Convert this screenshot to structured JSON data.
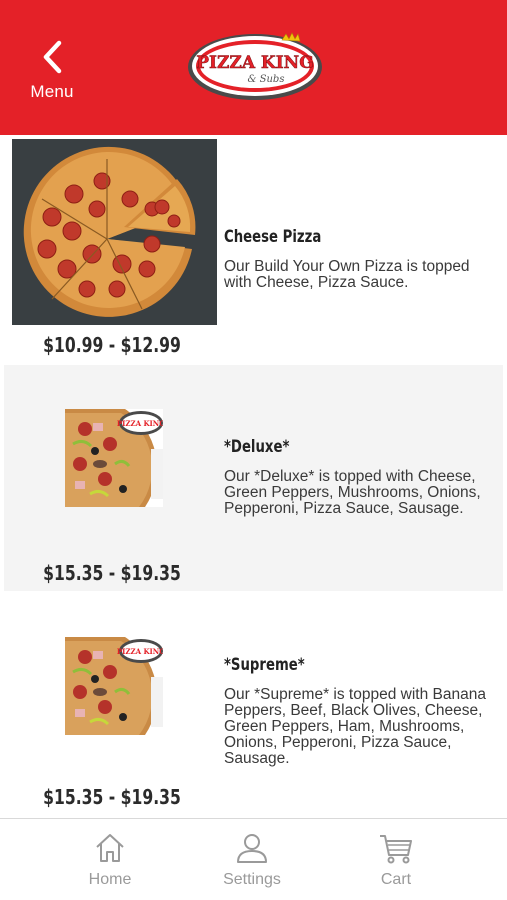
{
  "header": {
    "menu_label": "Menu",
    "logo_text_main": "Pizza King",
    "logo_text_sub": "& Subs",
    "accent_color": "#e42128"
  },
  "items": [
    {
      "name": "Cheese Pizza",
      "description": "Our Build Your Own Pizza is topped with Cheese, Pizza Sauce.",
      "price": "$10.99 - $12.99",
      "image": "pepperoni-pizza-photo"
    },
    {
      "name": "*Deluxe*",
      "description": "Our *Deluxe* is topped with Cheese, Green Peppers, Mushrooms, Onions, Pepperoni, Pizza Sauce, Sausage.",
      "price": "$15.35 - $19.35",
      "image": "supreme-pizza-logo-photo"
    },
    {
      "name": "*Supreme*",
      "description": "Our *Supreme* is topped with Banana Peppers, Beef, Black Olives, Cheese, Green Peppers, Ham, Mushrooms, Onions, Pepperoni, Pizza Sauce, Sausage.",
      "price": "$15.35 - $19.35",
      "image": "supreme-pizza-logo-photo"
    }
  ],
  "tabbar": {
    "tabs": [
      {
        "label": "Home",
        "icon": "home-icon"
      },
      {
        "label": "Settings",
        "icon": "user-icon"
      },
      {
        "label": "Cart",
        "icon": "cart-icon"
      }
    ]
  }
}
